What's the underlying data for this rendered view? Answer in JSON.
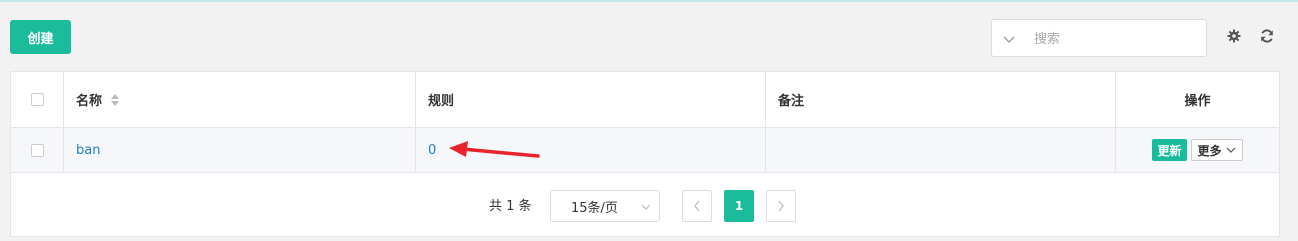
{
  "toolbar": {
    "create_label": "创建",
    "search_placeholder": "搜索",
    "search_value": ""
  },
  "table": {
    "columns": {
      "name": "名称",
      "rule": "规则",
      "note": "备注",
      "actions": "操作"
    },
    "rows": [
      {
        "name": "ban",
        "rule": "0",
        "note": ""
      }
    ],
    "row_actions": {
      "update_label": "更新",
      "more_label": "更多"
    }
  },
  "pagination": {
    "total_text": "共 1 条",
    "page_size": "15条/页",
    "current_page": "1"
  },
  "colors": {
    "accent": "#1abc9c",
    "link": "#1f7fc4",
    "annotation_arrow": "#e8242a"
  },
  "icons": [
    "chevron-down-icon",
    "gear-icon",
    "refresh-icon",
    "sort-icon",
    "chevron-left-icon",
    "chevron-right-icon",
    "arrow-annotation-icon"
  ]
}
